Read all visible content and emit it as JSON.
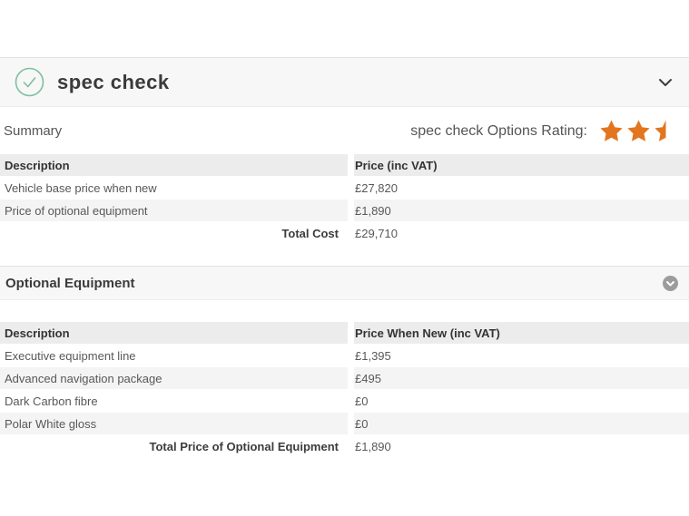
{
  "header": {
    "title": "spec check",
    "status_icon": "check-circle",
    "collapse_icon": "chevron-down"
  },
  "summary": {
    "label": "Summary",
    "rating_label": "spec check Options Rating:",
    "rating_value": 2.5,
    "rating_max": 5,
    "star_icon": "star"
  },
  "summary_table": {
    "columns": [
      "Description",
      "Price (inc VAT)"
    ],
    "rows": [
      {
        "description": "Vehicle base price when new",
        "price": "£27,820"
      },
      {
        "description": "Price of optional equipment",
        "price": "£1,890"
      }
    ],
    "total_label": "Total Cost",
    "total_value": "£29,710"
  },
  "optional_equipment": {
    "title": "Optional Equipment",
    "toggle_icon": "chevron-down-circle",
    "columns": [
      "Description",
      "Price When New (inc VAT)"
    ],
    "rows": [
      {
        "description": "Executive equipment line",
        "price": "£1,395"
      },
      {
        "description": "Advanced navigation package",
        "price": "£495"
      },
      {
        "description": "Dark Carbon fibre",
        "price": "£0"
      },
      {
        "description": "Polar White gloss",
        "price": "£0"
      }
    ],
    "total_label": "Total Price of Optional Equipment",
    "total_value": "£1,890"
  },
  "colors": {
    "star_orange": "#e2751d",
    "check_green": "#7fbf9e",
    "toggle_gray": "#9c9c9c",
    "bar_background": "#f7f7f7",
    "header_row_background": "#ececec",
    "alt_row_background": "#f4f4f4"
  }
}
